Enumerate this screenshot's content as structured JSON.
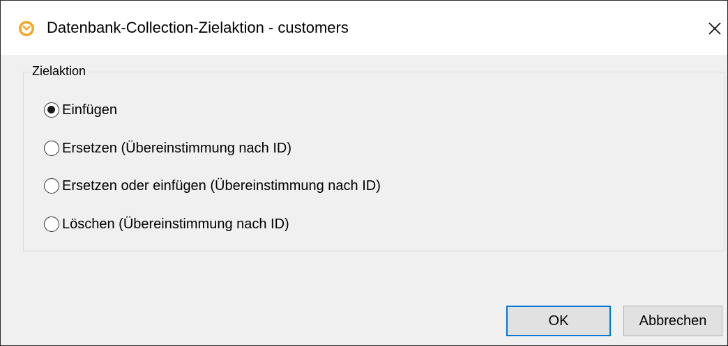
{
  "window": {
    "title": "Datenbank-Collection-Zielaktion - customers",
    "close_glyph": "✕",
    "app_icon": "altova-mapforce-icon"
  },
  "group": {
    "label": "Zielaktion",
    "options": [
      {
        "label": "Einfügen",
        "checked": true
      },
      {
        "label": "Ersetzen (Übereinstimmung nach ID)",
        "checked": false
      },
      {
        "label": "Ersetzen oder einfügen (Übereinstimmung nach ID)",
        "checked": false
      },
      {
        "label": "Löschen (Übereinstimmung nach ID)",
        "checked": false
      }
    ]
  },
  "buttons": {
    "ok_label": "OK",
    "cancel_label": "Abbrechen"
  },
  "colors": {
    "accent": "#0078d7",
    "icon_orange": "#f5a623"
  }
}
